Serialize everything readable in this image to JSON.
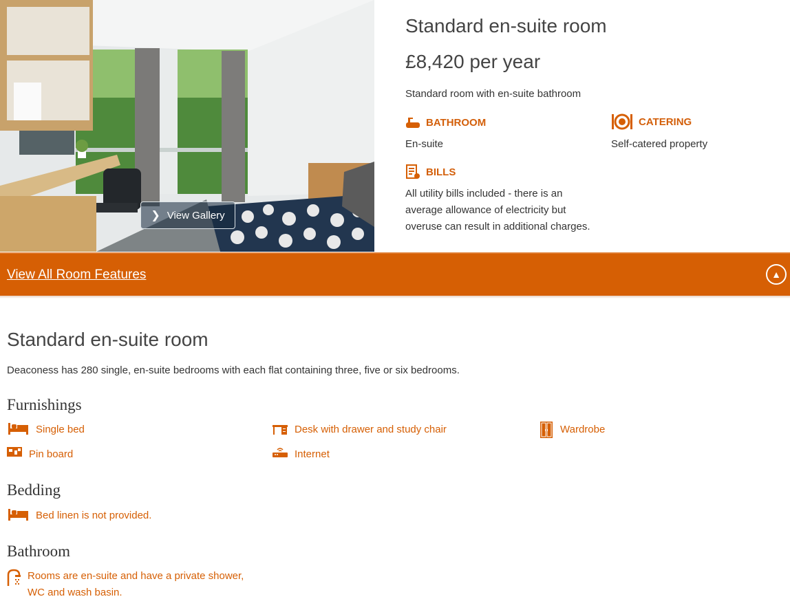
{
  "room": {
    "title": "Standard en-suite room",
    "price": "£8,420 per year",
    "description": "Standard room with en-suite bathroom",
    "gallery_label": "View Gallery"
  },
  "features": {
    "bathroom": {
      "label": "BATHROOM",
      "value": "En-suite",
      "icon": "bath-icon"
    },
    "catering": {
      "label": "CATERING",
      "value": "Self-catered property",
      "icon": "plate-cutlery-icon"
    },
    "bills": {
      "label": "BILLS",
      "value_lines": [
        "All utility bills included - there is an",
        "average allowance of electricity but",
        "overuse can result in additional charges."
      ],
      "icon": "bill-icon"
    }
  },
  "band": {
    "link_label": "View All Room Features",
    "toggle_icon": "chevron-up-icon",
    "color": "#d65f04"
  },
  "details": {
    "title": "Standard en-suite room",
    "description": "Deaconess has 280 single, en-suite bedrooms with each flat containing three, five or six bedrooms.",
    "furnishings": {
      "heading": "Furnishings",
      "items": [
        {
          "label": "Single bed",
          "icon": "bed-icon"
        },
        {
          "label": "Desk with drawer and study chair",
          "icon": "desk-icon"
        },
        {
          "label": "Wardrobe",
          "icon": "wardrobe-icon"
        },
        {
          "label": "Pin board",
          "icon": "pin-board-icon"
        },
        {
          "label": "Internet",
          "icon": "router-icon"
        }
      ]
    },
    "bedding": {
      "heading": "Bedding",
      "items": [
        {
          "label": "Bed linen is not provided.",
          "icon": "bed-icon"
        }
      ]
    },
    "bathroom": {
      "heading": "Bathroom",
      "items": [
        {
          "label_lines": [
            "Rooms are en-suite and have a private shower,",
            "WC and wash basin."
          ],
          "icon": "shower-icon"
        }
      ]
    }
  },
  "accent_color": "#d65f04"
}
